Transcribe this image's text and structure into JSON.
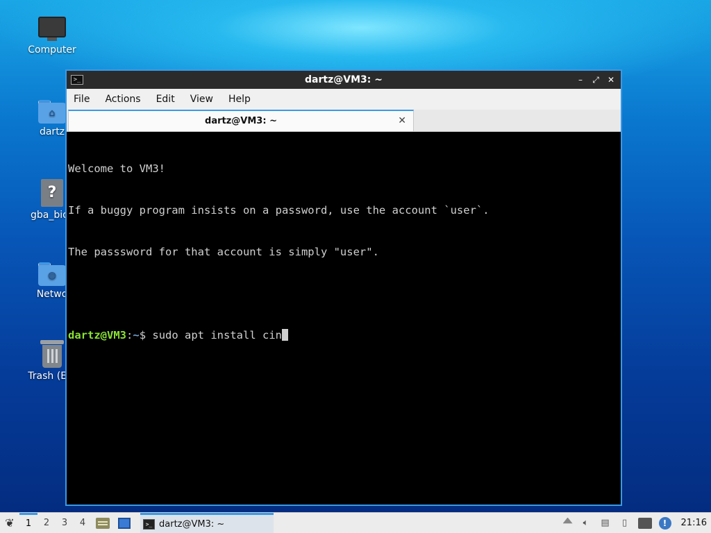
{
  "desktop": {
    "icons": [
      {
        "label": "Computer",
        "icon": "computer-icon"
      },
      {
        "label": "dartz",
        "icon": "home-folder-icon"
      },
      {
        "label": "gba_bios",
        "icon": "unknown-file-icon"
      },
      {
        "label": "Netwo",
        "icon": "network-folder-icon"
      },
      {
        "label": "Trash (Em",
        "icon": "trash-icon"
      }
    ]
  },
  "window": {
    "title": "dartz@VM3: ~",
    "controls": {
      "minimize": "–",
      "maximize": "⤢",
      "close": "✕"
    },
    "menu": [
      "File",
      "Actions",
      "Edit",
      "View",
      "Help"
    ],
    "tab": {
      "label": "dartz@VM3: ~",
      "close": "✕"
    },
    "terminal": {
      "lines": [
        "Welcome to VM3!",
        "If a buggy program insists on a password, use the account `user`.",
        "The passsword for that account is simply \"user\"."
      ],
      "prompt_user": "dartz@VM3",
      "prompt_sep": ":",
      "prompt_path": "~",
      "prompt_symbol": "$ ",
      "command": "sudo apt install cin"
    }
  },
  "taskbar": {
    "menu_icon": "start-menu-icon",
    "workspaces": [
      "1",
      "2",
      "3",
      "4"
    ],
    "active_workspace": "1",
    "task_label": "dartz@VM3: ~",
    "clock": "21:16"
  },
  "colors": {
    "accent": "#3a99e8",
    "prompt_user": "#8ae234",
    "prompt_path": "#729fcf",
    "terminal_bg": "#000000"
  }
}
